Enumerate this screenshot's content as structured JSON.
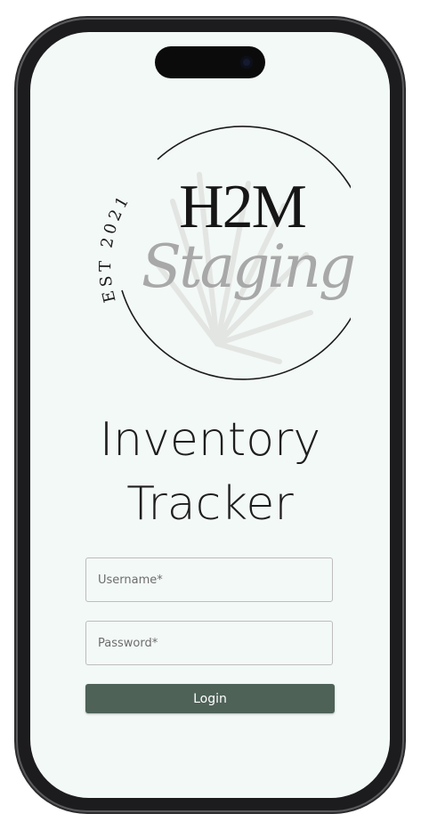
{
  "logo": {
    "brand_top": "H2M",
    "brand_bottom": "Staging",
    "established": "EST 2021"
  },
  "title": {
    "line1": "Inventory",
    "line2": "Tracker"
  },
  "form": {
    "username_placeholder": "Username*",
    "password_placeholder": "Password*",
    "login_label": "Login"
  },
  "colors": {
    "screen_background": "#f3f9f6",
    "login_button": "#4e6258",
    "logo_script": "#a8a8a8"
  }
}
